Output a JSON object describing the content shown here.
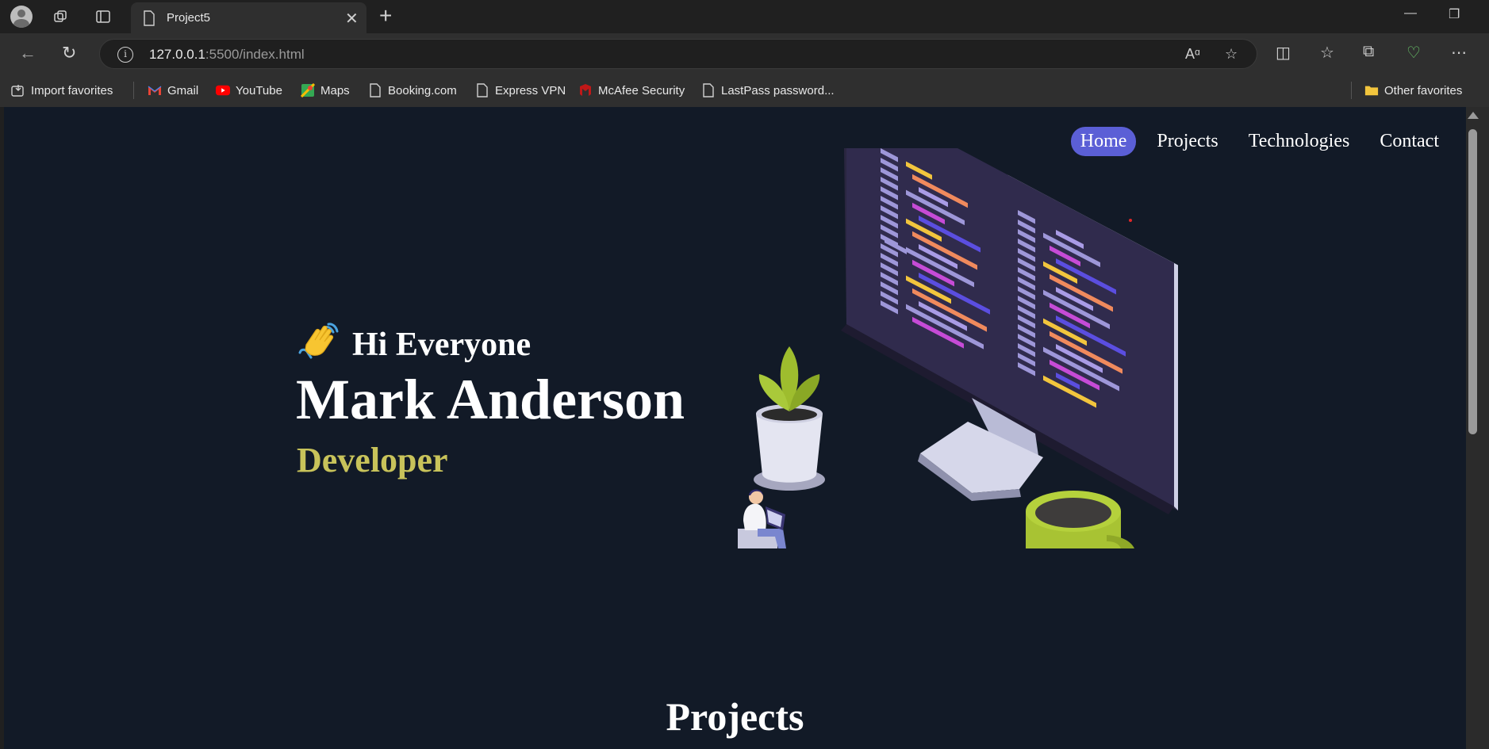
{
  "browser": {
    "tab_title": "Project5",
    "url_host": "127.0.0.1",
    "url_path": ":5500/index.html",
    "favorites": [
      {
        "label": "Import favorites",
        "icon": "import-icon"
      },
      {
        "label": "Gmail",
        "icon": "gmail-icon"
      },
      {
        "label": "YouTube",
        "icon": "youtube-icon"
      },
      {
        "label": "Maps",
        "icon": "maps-icon"
      },
      {
        "label": "Booking.com",
        "icon": "page-icon"
      },
      {
        "label": "Express VPN",
        "icon": "page-icon"
      },
      {
        "label": "McAfee Security",
        "icon": "mcafee-icon"
      },
      {
        "label": "LastPass password...",
        "icon": "page-icon"
      }
    ],
    "other_favorites": "Other favorites"
  },
  "site": {
    "nav": [
      {
        "label": "Home",
        "active": true
      },
      {
        "label": "Projects",
        "active": false
      },
      {
        "label": "Technologies",
        "active": false
      },
      {
        "label": "Contact",
        "active": false
      }
    ],
    "hero": {
      "wave_emoji": "👋",
      "greeting": "Hi Everyone",
      "name": "Mark Anderson",
      "role": "Developer"
    },
    "projects_heading": "Projects"
  },
  "colors": {
    "page_bg": "#121a27",
    "accent": "#5b5fd6",
    "role": "#c8c35a"
  }
}
